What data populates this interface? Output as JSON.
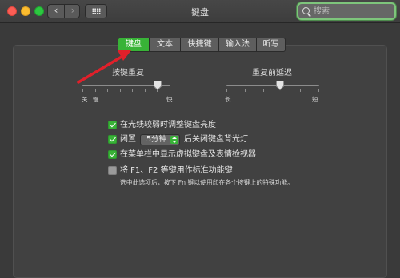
{
  "window": {
    "title": "键盘",
    "search_placeholder": "搜索"
  },
  "tabs": [
    {
      "label": "键盘",
      "active": true
    },
    {
      "label": "文本",
      "active": false
    },
    {
      "label": "快捷键",
      "active": false
    },
    {
      "label": "输入法",
      "active": false
    },
    {
      "label": "听写",
      "active": false
    }
  ],
  "key_repeat": {
    "label": "按键重复",
    "min_label": "关",
    "slow_label": "慢",
    "max_label": "快",
    "value_fraction": 0.85
  },
  "delay_until_repeat": {
    "label": "重复前延迟",
    "min_label": "长",
    "max_label": "短",
    "value_fraction": 0.58
  },
  "options": {
    "adjust_brightness": {
      "label": "在光线较弱时调整键盘亮度",
      "checked": true
    },
    "backlight_off": {
      "prefix": "闭置",
      "popup_value": "5分钟",
      "suffix": "后关闭键盘背光灯",
      "checked": true
    },
    "show_viewers": {
      "label": "在菜单栏中显示虚拟键盘及表情检视器",
      "checked": true
    },
    "fn_keys": {
      "label": "将 F1、F2 等键用作标准功能键",
      "checked": false,
      "note": "选中此选项后，按下 Fn 键以使用印在各个按键上的特殊功能。"
    }
  },
  "colors": {
    "accent_green": "#38b337",
    "annotation_arrow": "#e0202a",
    "close": "#fc5e55",
    "minimize": "#fcbd2f",
    "zoom": "#2cc840"
  }
}
